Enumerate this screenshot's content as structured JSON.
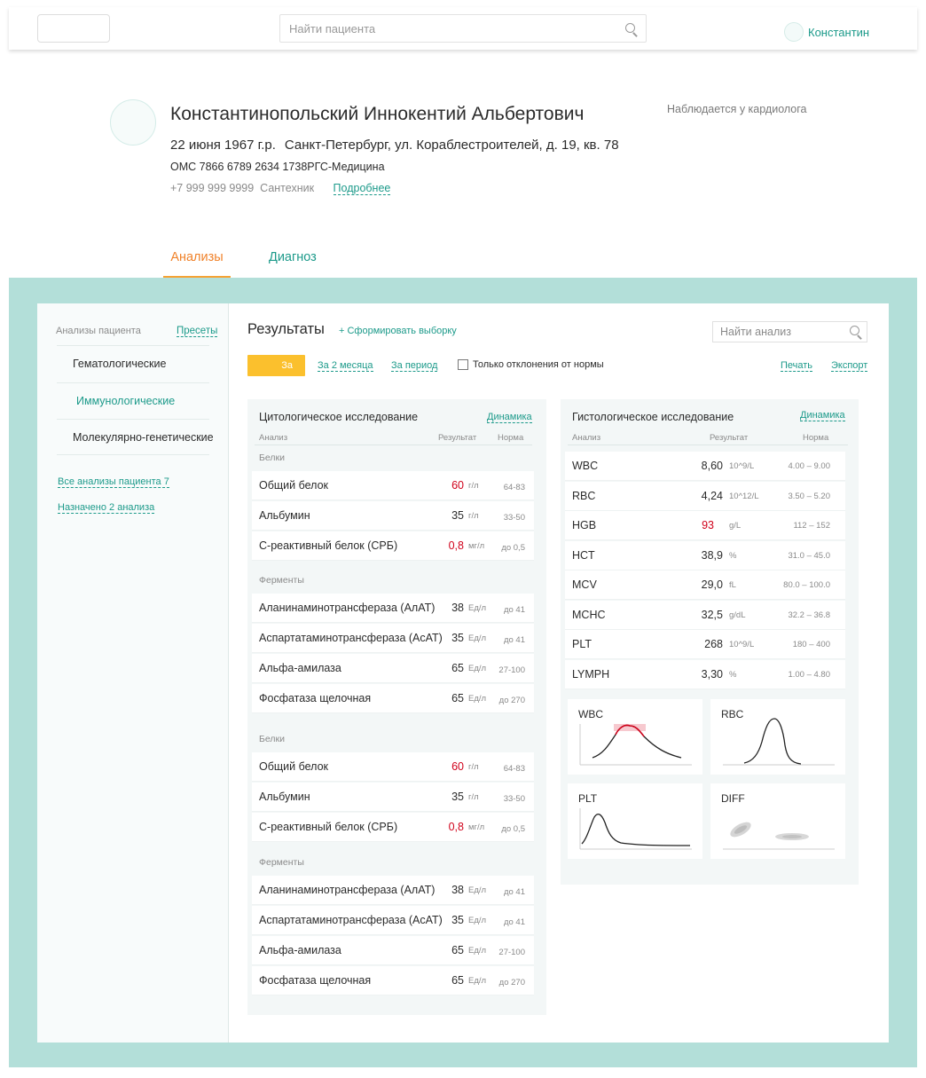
{
  "header": {
    "search_placeholder": "Найти пациента",
    "user_name": "Константин"
  },
  "patient": {
    "name": "Константинопольский Иннокентий Альбертович",
    "birthdate": "22 июня 1967 г.р.",
    "address": "Санкт-Петербург, ул. Кораблестроителей, д. 19, кв. 78",
    "insurance": "ОМС 7866 6789 2634 1738РГС-Медицина",
    "phone": "+7 999 999 9999",
    "occupation": "Сантехник",
    "more_link": "Подробнее",
    "observed": "Наблюдается у кардиолога"
  },
  "tabs": [
    {
      "label": "Анализы",
      "active": true
    },
    {
      "label": "Диагноз",
      "active": false
    }
  ],
  "sidebar": {
    "header": "Анализы пациента",
    "presets": "Пресеты",
    "items": [
      {
        "label": "Гематологические",
        "active": false
      },
      {
        "label": "Иммунологические",
        "active": true
      },
      {
        "label": "Молекулярно-генетические",
        "active": false
      }
    ],
    "all_link": "Все анализы пациента  7",
    "assigned_link": "Назначено 2 анализа"
  },
  "results": {
    "title": "Результаты",
    "form_selection": "+ Сформировать выборку",
    "search_placeholder": "Найти анализ",
    "period_button": "За",
    "filter_2months": "За 2 месяца",
    "filter_period": "За период",
    "only_deviations": "Только отклонения от нормы",
    "only_deviations_checked": false,
    "print": "Печать",
    "export": "Экспорт"
  },
  "cytology": {
    "title": "Цитологическое исследование",
    "dynamics": "Динамика",
    "col_analysis": "Анализ",
    "col_result": "Результат",
    "col_norm": "Норма",
    "groups": [
      {
        "name": "Белки",
        "rows": [
          {
            "name": "Общий белок",
            "value": "60",
            "unit": "г/л",
            "norm": "64-83",
            "abnormal": true
          },
          {
            "name": "Альбумин",
            "value": "35",
            "unit": "г/л",
            "norm": "33-50",
            "abnormal": false
          },
          {
            "name": "С-реактивный белок (СРБ)",
            "value": "0,8",
            "unit": "мг/л",
            "norm": "до 0,5",
            "abnormal": true
          }
        ]
      },
      {
        "name": "Ферменты",
        "rows": [
          {
            "name": "Аланинаминотрансфераза (АлАТ)",
            "value": "38",
            "unit": "Ед/л",
            "norm": "до 41",
            "abnormal": false
          },
          {
            "name": "Аспартатаминотрансфераза (АсАТ)",
            "value": "35",
            "unit": "Ед/л",
            "norm": "до 41",
            "abnormal": false
          },
          {
            "name": "Альфа-амилаза",
            "value": "65",
            "unit": "Ед/л",
            "norm": "27-100",
            "abnormal": false
          },
          {
            "name": "Фосфатаза щелочная",
            "value": "65",
            "unit": "Ед/л",
            "norm": "до 270",
            "abnormal": false
          }
        ]
      },
      {
        "name": "Белки",
        "rows": [
          {
            "name": "Общий белок",
            "value": "60",
            "unit": "г/л",
            "norm": "64-83",
            "abnormal": true
          },
          {
            "name": "Альбумин",
            "value": "35",
            "unit": "г/л",
            "norm": "33-50",
            "abnormal": false
          },
          {
            "name": "С-реактивный белок (СРБ)",
            "value": "0,8",
            "unit": "мг/л",
            "norm": "до 0,5",
            "abnormal": true
          }
        ]
      },
      {
        "name": "Ферменты",
        "rows": [
          {
            "name": "Аланинаминотрансфераза (АлАТ)",
            "value": "38",
            "unit": "Ед/л",
            "norm": "до 41",
            "abnormal": false
          },
          {
            "name": "Аспартатаминотрансфераза (АсАТ)",
            "value": "35",
            "unit": "Ед/л",
            "norm": "до 41",
            "abnormal": false
          },
          {
            "name": "Альфа-амилаза",
            "value": "65",
            "unit": "Ед/л",
            "norm": "27-100",
            "abnormal": false
          },
          {
            "name": "Фосфатаза щелочная",
            "value": "65",
            "unit": "Ед/л",
            "norm": "до 270",
            "abnormal": false
          }
        ]
      }
    ]
  },
  "histology": {
    "title": "Гистологическое исследование",
    "dynamics": "Динамика",
    "col_analysis": "Анализ",
    "col_result": "Результат",
    "col_norm": "Норма",
    "rows": [
      {
        "name": "WBC",
        "value": "8,60",
        "unit": "10^9/L",
        "norm": "4.00 – 9.00",
        "abnormal": false
      },
      {
        "name": "RBC",
        "value": "4,24",
        "unit": "10^12/L",
        "norm": "3.50 – 5.20",
        "abnormal": false
      },
      {
        "name": "HGB",
        "value": "93",
        "unit": "g/L",
        "norm": "112 – 152",
        "abnormal": true
      },
      {
        "name": "HCT",
        "value": "38,9",
        "unit": "%",
        "norm": "31.0 – 45.0",
        "abnormal": false
      },
      {
        "name": "MCV",
        "value": "29,0",
        "unit": "fL",
        "norm": "80.0 – 100.0",
        "abnormal": false
      },
      {
        "name": "MCHC",
        "value": "32,5",
        "unit": "g/dL",
        "norm": "32.2 – 36.8",
        "abnormal": false
      },
      {
        "name": "PLT",
        "value": "268",
        "unit": "10^9/L",
        "norm": "180 – 400",
        "abnormal": false
      },
      {
        "name": "LYMPH",
        "value": "3,30",
        "unit": "%",
        "norm": "1.00 – 4.80",
        "abnormal": false
      }
    ],
    "histograms": [
      {
        "label": "WBC"
      },
      {
        "label": "RBC"
      },
      {
        "label": "PLT"
      },
      {
        "label": "DIFF"
      }
    ]
  },
  "colors": {
    "accent": "#1c9a8a",
    "tab_active": "#f0822a",
    "period_button": "#fbc02d",
    "abnormal": "#d0021b",
    "background_teal": "#b3dfd9"
  }
}
